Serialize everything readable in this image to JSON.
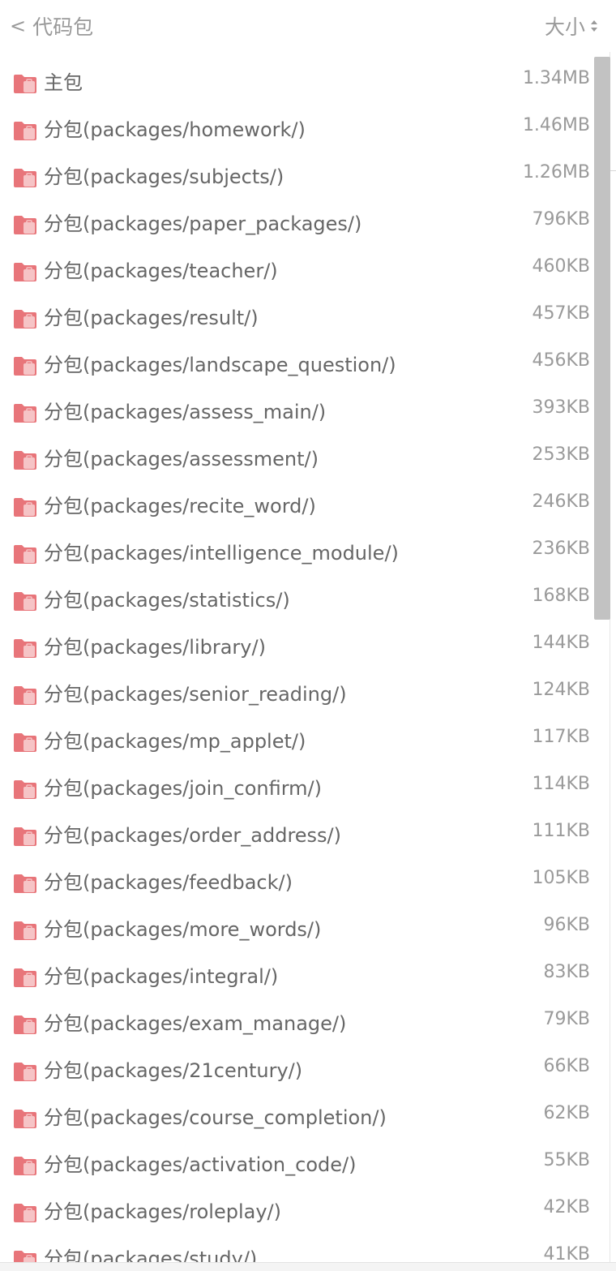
{
  "header": {
    "back_label": "代码包",
    "sort_label": "大小"
  },
  "packages": [
    {
      "name": "主包",
      "size": "1.34MB"
    },
    {
      "name": "分包(packages/homework/)",
      "size": "1.46MB"
    },
    {
      "name": "分包(packages/subjects/)",
      "size": "1.26MB"
    },
    {
      "name": "分包(packages/paper_packages/)",
      "size": "796KB"
    },
    {
      "name": "分包(packages/teacher/)",
      "size": "460KB"
    },
    {
      "name": "分包(packages/result/)",
      "size": "457KB"
    },
    {
      "name": "分包(packages/landscape_question/)",
      "size": "456KB"
    },
    {
      "name": "分包(packages/assess_main/)",
      "size": "393KB"
    },
    {
      "name": "分包(packages/assessment/)",
      "size": "253KB"
    },
    {
      "name": "分包(packages/recite_word/)",
      "size": "246KB"
    },
    {
      "name": "分包(packages/intelligence_module/)",
      "size": "236KB"
    },
    {
      "name": "分包(packages/statistics/)",
      "size": "168KB"
    },
    {
      "name": "分包(packages/library/)",
      "size": "144KB"
    },
    {
      "name": "分包(packages/senior_reading/)",
      "size": "124KB"
    },
    {
      "name": "分包(packages/mp_applet/)",
      "size": "117KB"
    },
    {
      "name": "分包(packages/join_confirm/)",
      "size": "114KB"
    },
    {
      "name": "分包(packages/order_address/)",
      "size": "111KB"
    },
    {
      "name": "分包(packages/feedback/)",
      "size": "105KB"
    },
    {
      "name": "分包(packages/more_words/)",
      "size": "96KB"
    },
    {
      "name": "分包(packages/integral/)",
      "size": "83KB"
    },
    {
      "name": "分包(packages/exam_manage/)",
      "size": "79KB"
    },
    {
      "name": "分包(packages/21century/)",
      "size": "66KB"
    },
    {
      "name": "分包(packages/course_completion/)",
      "size": "62KB"
    },
    {
      "name": "分包(packages/activation_code/)",
      "size": "55KB"
    },
    {
      "name": "分包(packages/roleplay/)",
      "size": "42KB"
    },
    {
      "name": "分包(packages/study/)",
      "size": "41KB"
    }
  ],
  "icon": "folder-icon",
  "colors": {
    "folder": "#e8757a",
    "folder_badge": "#f6c4c6",
    "scrollbar": "#c2c2c2"
  }
}
